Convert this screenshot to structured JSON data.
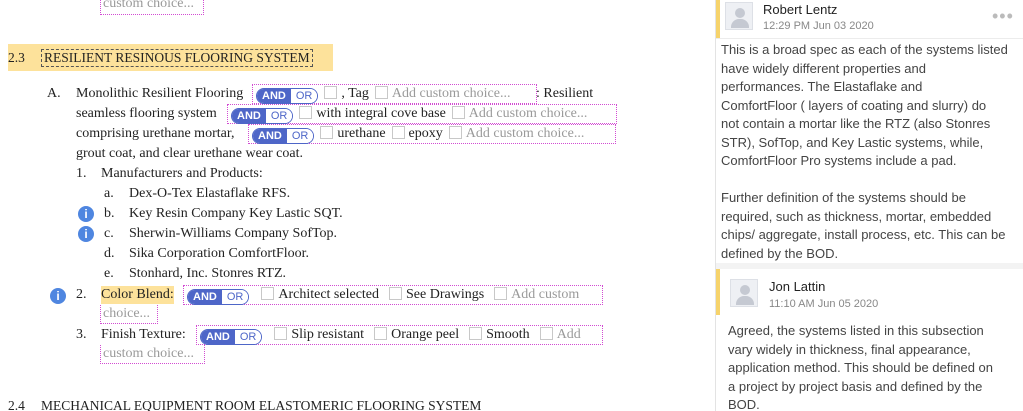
{
  "top_fragment": {
    "choice": "custom choice..."
  },
  "section_23": {
    "number": "2.3",
    "title": "RESILIENT RESINOUS FLOORING SYSTEM"
  },
  "para_a": {
    "letter": "A.",
    "line1_pre": "Monolithic Resilient Flooring",
    "tag_label": ", Tag",
    "add_custom_1": "Add custom choice...",
    "line1_post": ": Resilient",
    "line2_pre": "seamless flooring system",
    "opt_cove": "with integral cove base",
    "add_custom_2": "Add custom choice...",
    "line3_pre": "comprising urethane mortar,",
    "opt_urethane": "urethane",
    "opt_epoxy": "epoxy",
    "add_custom_3": "Add custom choice...",
    "line4": "grout coat, and clear urethane wear coat."
  },
  "toggle": {
    "on": "AND",
    "off": "OR"
  },
  "list": {
    "item1_num": "1.",
    "item1_label": "Manufacturers and Products:",
    "manufacturers": [
      {
        "letter": "a.",
        "name": "Dex-O-Tex Elastaflake RFS."
      },
      {
        "letter": "b.",
        "name": "Key Resin Company Key Lastic SQT."
      },
      {
        "letter": "c.",
        "name": "Sherwin-Williams Company SofTop."
      },
      {
        "letter": "d.",
        "name": "Sika Corporation ComfortFloor."
      },
      {
        "letter": "e.",
        "name": "Stonhard, Inc. Stonres RTZ."
      }
    ],
    "item2_num": "2.",
    "item2_label": "Color Blend:",
    "opt_architect": "Architect selected",
    "opt_drawings": "See Drawings",
    "add_custom_4a": "Add custom",
    "add_custom_4b": "choice...",
    "item3_num": "3.",
    "item3_label": "Finish Texture:",
    "opt_slip": "Slip resistant",
    "opt_orange": "Orange peel",
    "opt_smooth": "Smooth",
    "add_custom_5a": "Add",
    "add_custom_5b": "custom choice..."
  },
  "section_24": {
    "number": "2.4",
    "title": "MECHANICAL EQUIPMENT ROOM ELASTOMERIC FLOORING SYSTEM"
  },
  "info_icon": {
    "glyph": "i"
  },
  "more_icon": {
    "glyph": "•••"
  },
  "comments": [
    {
      "author": "Robert Lentz",
      "date": "12:29 PM Jun 03 2020",
      "lines": [
        "This is a broad spec as each of the systems listed",
        "have widely different properties and",
        "performances.  The Elastaflake and",
        "ComfortFloor ( layers of coating and slurry) do",
        "not contain a mortar  like the RTZ (also Stonres",
        "STR), SofTop, and Key Lastic systems, while,",
        "ComfortFloor Pro systems include a pad.",
        "",
        "Further definition of the systems should be",
        "required, such as thickness, mortar, embedded",
        "chips/ aggregate, install process, etc.  This can be",
        "defined by the BOD."
      ]
    },
    {
      "author": "Jon Lattin",
      "date": "11:10 AM Jun 05 2020",
      "lines": [
        "Agreed, the systems listed in this subsection",
        "vary widely in thickness, final appearance,",
        "application method.  This should be defined on",
        "a project by project basis and defined by the",
        "BOD."
      ]
    }
  ]
}
